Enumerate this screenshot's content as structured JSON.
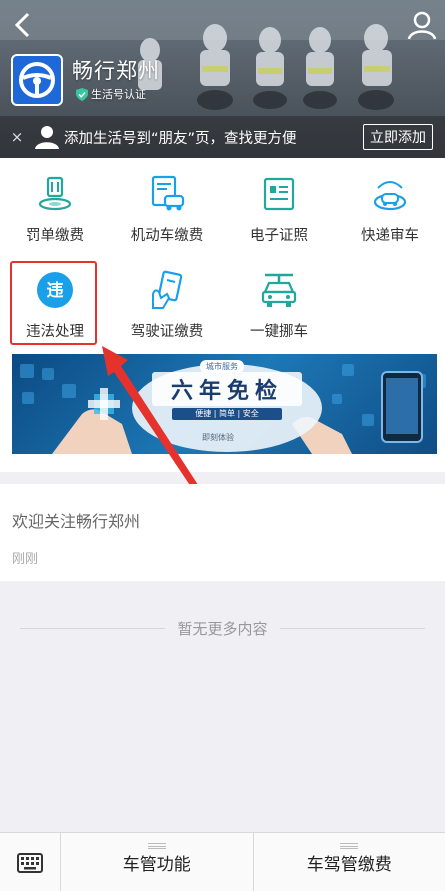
{
  "header": {
    "account_name": "畅行郑州",
    "verified_label": "生活号认证",
    "back_icon": "chevron-left-icon",
    "profile_icon": "person-icon"
  },
  "promo": {
    "close_label": "×",
    "text": "添加生活号到“朋友”页，查找更方便",
    "add_button": "立即添加"
  },
  "menu": {
    "items": [
      {
        "label": "罚单缴费",
        "icon": "fine-payment-icon"
      },
      {
        "label": "机动车缴费",
        "icon": "vehicle-payment-icon"
      },
      {
        "label": "电子证照",
        "icon": "e-license-icon"
      },
      {
        "label": "快递审车",
        "icon": "express-inspection-icon"
      },
      {
        "label": "违法处理",
        "icon": "violation-icon"
      },
      {
        "label": "驾驶证缴费",
        "icon": "license-payment-icon"
      },
      {
        "label": "一键挪车",
        "icon": "move-car-icon"
      }
    ],
    "violation_badge": "违"
  },
  "banner": {
    "tag": "城市服务",
    "title": "六年免检",
    "subtitle": "便捷 | 简单 | 安全",
    "footer": "即刻体验"
  },
  "message": {
    "title": "欢迎关注畅行郑州",
    "time": "刚刚"
  },
  "no_more_text": "暂无更多内容",
  "bottom_bar": {
    "keyboard_icon": "keyboard-icon",
    "tabs": [
      {
        "label": "车管功能"
      },
      {
        "label": "车驾管缴费"
      }
    ]
  },
  "colors": {
    "accent": "#1aa0e8",
    "teal_icon": "#21a79b",
    "highlight": "#e5322d",
    "logo_blue": "#1e68d8"
  }
}
